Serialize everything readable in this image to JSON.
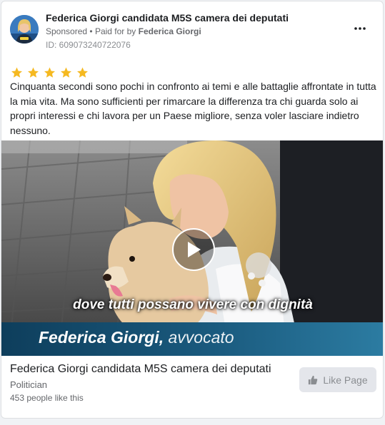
{
  "post": {
    "page_name": "Federica Giorgi candidata M5S camera dei deputati",
    "sponsored_label": "Sponsored",
    "separator": "•",
    "paid_for_prefix": "Paid for by",
    "paid_for_name": "Federica Giorgi",
    "ad_id": "ID: 609073240722076",
    "more_icon": "more-horizontal-icon",
    "star_count": 5,
    "star_color": "#f5b921",
    "body": "Cinquanta secondi sono pochi in confronto ai temi e alle battaglie affrontate in tutta la mia vita. Ma sono sufficienti per rimarcare la differenza tra chi guarda solo ai propri interessi e chi lavora per un Paese migliore, senza voler lasciare indietro nessuno."
  },
  "video": {
    "caption": "dove tutti possano vivere con dignità",
    "lower_third_name": "Federica Giorgi,",
    "lower_third_role": "avvocato",
    "play_icon": "play-icon"
  },
  "footer": {
    "title": "Federica Giorgi candidata M5S camera dei deputati",
    "category": "Politician",
    "likes": "453 people like this",
    "like_button_label": "Like Page",
    "like_icon": "thumbs-up-icon"
  }
}
